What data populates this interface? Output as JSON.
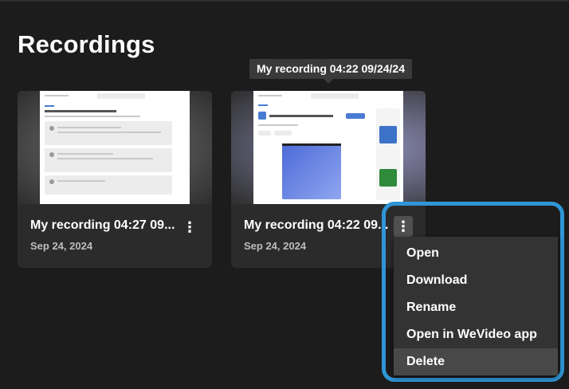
{
  "page": {
    "title": "Recordings"
  },
  "recordings": [
    {
      "title": "My recording 04:27 09...",
      "date": "Sep 24, 2024"
    },
    {
      "title": "My recording 04:22 09...",
      "date": "Sep 24, 2024"
    }
  ],
  "tooltip": {
    "text": "My recording 04:22 09/24/24"
  },
  "menu": {
    "items": [
      "Open",
      "Download",
      "Rename",
      "Open in WeVideo app",
      "Delete"
    ],
    "hovered_index": 4
  },
  "colors": {
    "background": "#1c1c1c",
    "card": "#2b2b2b",
    "menu": "#333333",
    "highlight": "#2f96d6"
  },
  "icons": {
    "more": "vertical-ellipsis-icon"
  }
}
